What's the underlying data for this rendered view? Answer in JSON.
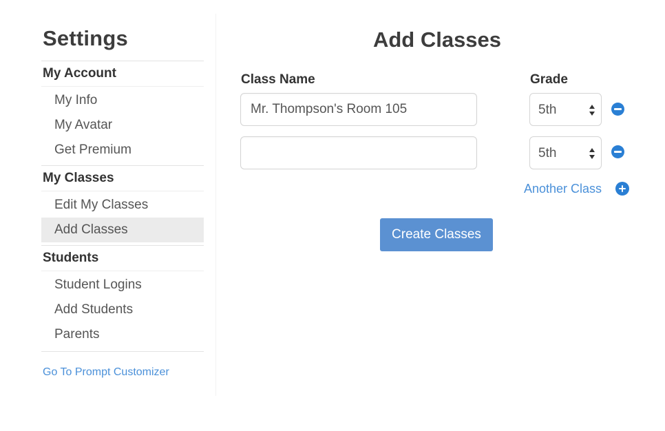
{
  "sidebar": {
    "title": "Settings",
    "sections": [
      {
        "header": "My Account",
        "items": [
          {
            "label": "My Info"
          },
          {
            "label": "My Avatar"
          },
          {
            "label": "Get Premium"
          }
        ]
      },
      {
        "header": "My Classes",
        "items": [
          {
            "label": "Edit My Classes"
          },
          {
            "label": "Add Classes",
            "active": true
          }
        ]
      },
      {
        "header": "Students",
        "items": [
          {
            "label": "Student Logins"
          },
          {
            "label": "Add Students"
          },
          {
            "label": "Parents"
          }
        ]
      }
    ],
    "footer_link": "Go To Prompt Customizer"
  },
  "main": {
    "title": "Add Classes",
    "class_name_label": "Class Name",
    "grade_label": "Grade",
    "rows": [
      {
        "class_name": "Mr. Thompson's Room 105",
        "grade": "5th"
      },
      {
        "class_name": "",
        "grade": "5th"
      }
    ],
    "another_class_label": "Another Class",
    "create_button_label": "Create Classes"
  },
  "colors": {
    "link": "#4a90d9",
    "icon_blue": "#2a7fd4",
    "primary_button": "#5b91d2",
    "active_item_bg": "#ebebeb"
  },
  "icons": {
    "remove_row": "minus-circle-icon",
    "add_row": "plus-circle-icon",
    "select_arrows": "up-down-arrows-icon"
  }
}
